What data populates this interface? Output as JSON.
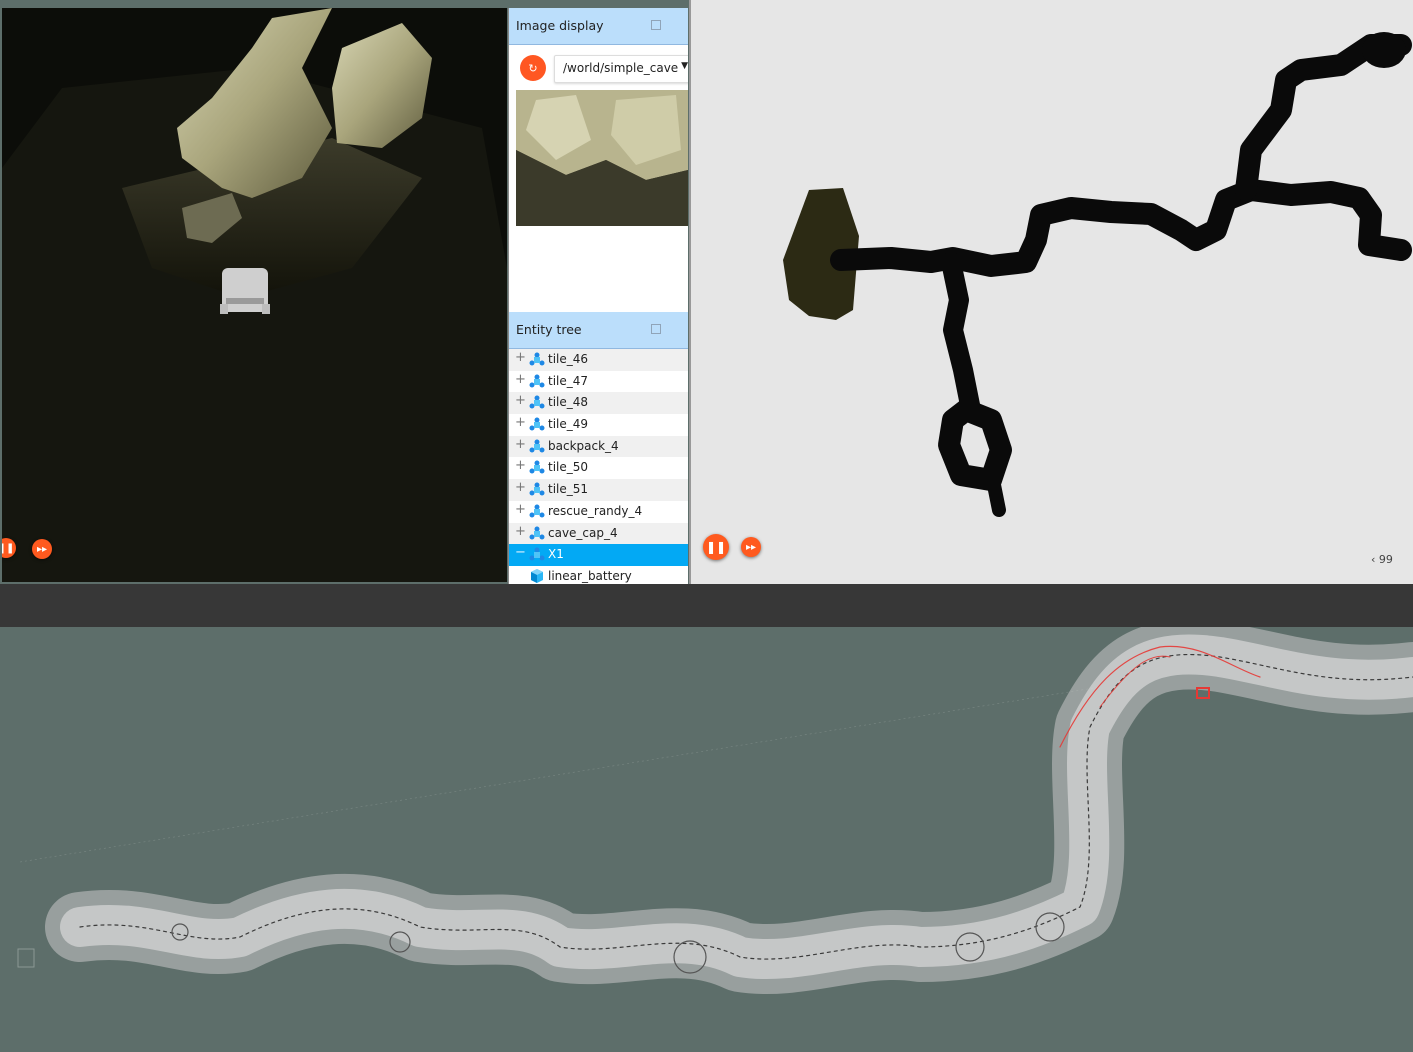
{
  "image_display": {
    "title": "Image display",
    "topic": "/world/simple_cave"
  },
  "entity_tree": {
    "title": "Entity tree",
    "items": [
      {
        "label": "tile_46"
      },
      {
        "label": "tile_47"
      },
      {
        "label": "tile_48"
      },
      {
        "label": "tile_49"
      },
      {
        "label": "backpack_4"
      },
      {
        "label": "tile_50"
      },
      {
        "label": "tile_51"
      },
      {
        "label": "rescue_randy_4"
      },
      {
        "label": "cave_cap_4"
      },
      {
        "label": "X1",
        "selected": true
      },
      {
        "label": "linear_battery"
      }
    ]
  },
  "map_panel": {
    "pager_text": "‹   99"
  },
  "colors": {
    "accent": "#ff5722",
    "panel_header": "#bbdefb",
    "selection": "#03a9f4",
    "cloud_background": "#5d6e6a"
  },
  "icons": {
    "model": "model-icon",
    "link": "link-icon",
    "play_pause": "pause-icon",
    "step": "fast-forward-icon",
    "refresh": "refresh-icon"
  }
}
